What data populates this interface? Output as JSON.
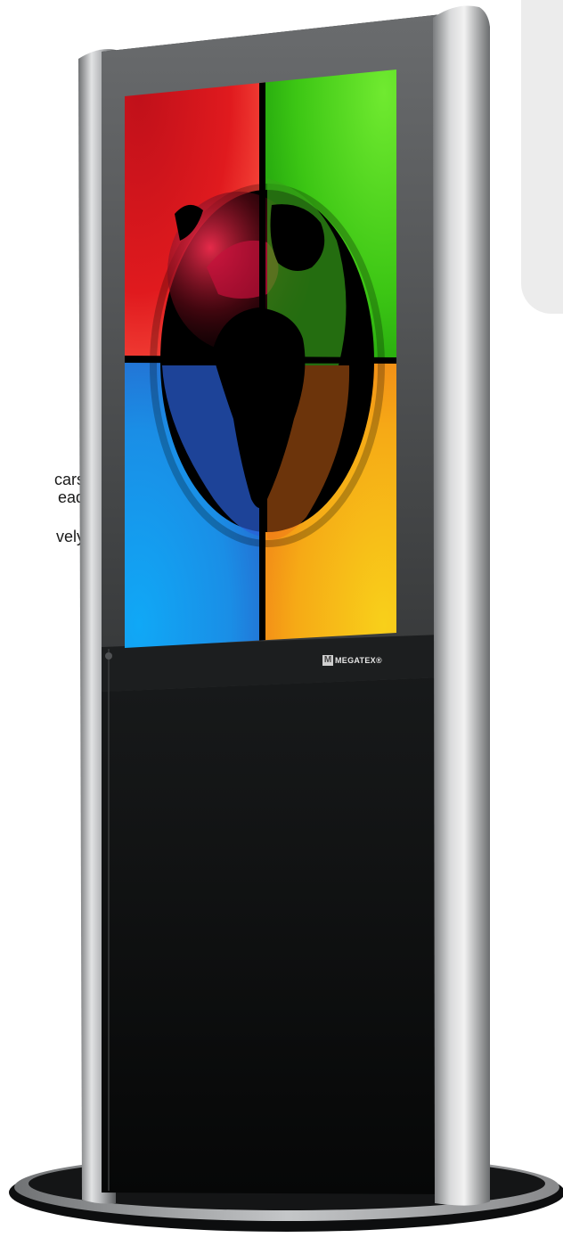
{
  "background_text": {
    "line1": "cars",
    "line2": "ead",
    "line3": "vely"
  },
  "kiosk": {
    "brand": "MEGATEX",
    "brand_mark": "M",
    "brand_suffix": "®",
    "screen_colors": {
      "red": "#d8141c",
      "green": "#48d018",
      "blue": "#1aa0f0",
      "yellow": "#f6b018"
    },
    "frame_color": "#a8aaac",
    "body_color": "#101212"
  }
}
